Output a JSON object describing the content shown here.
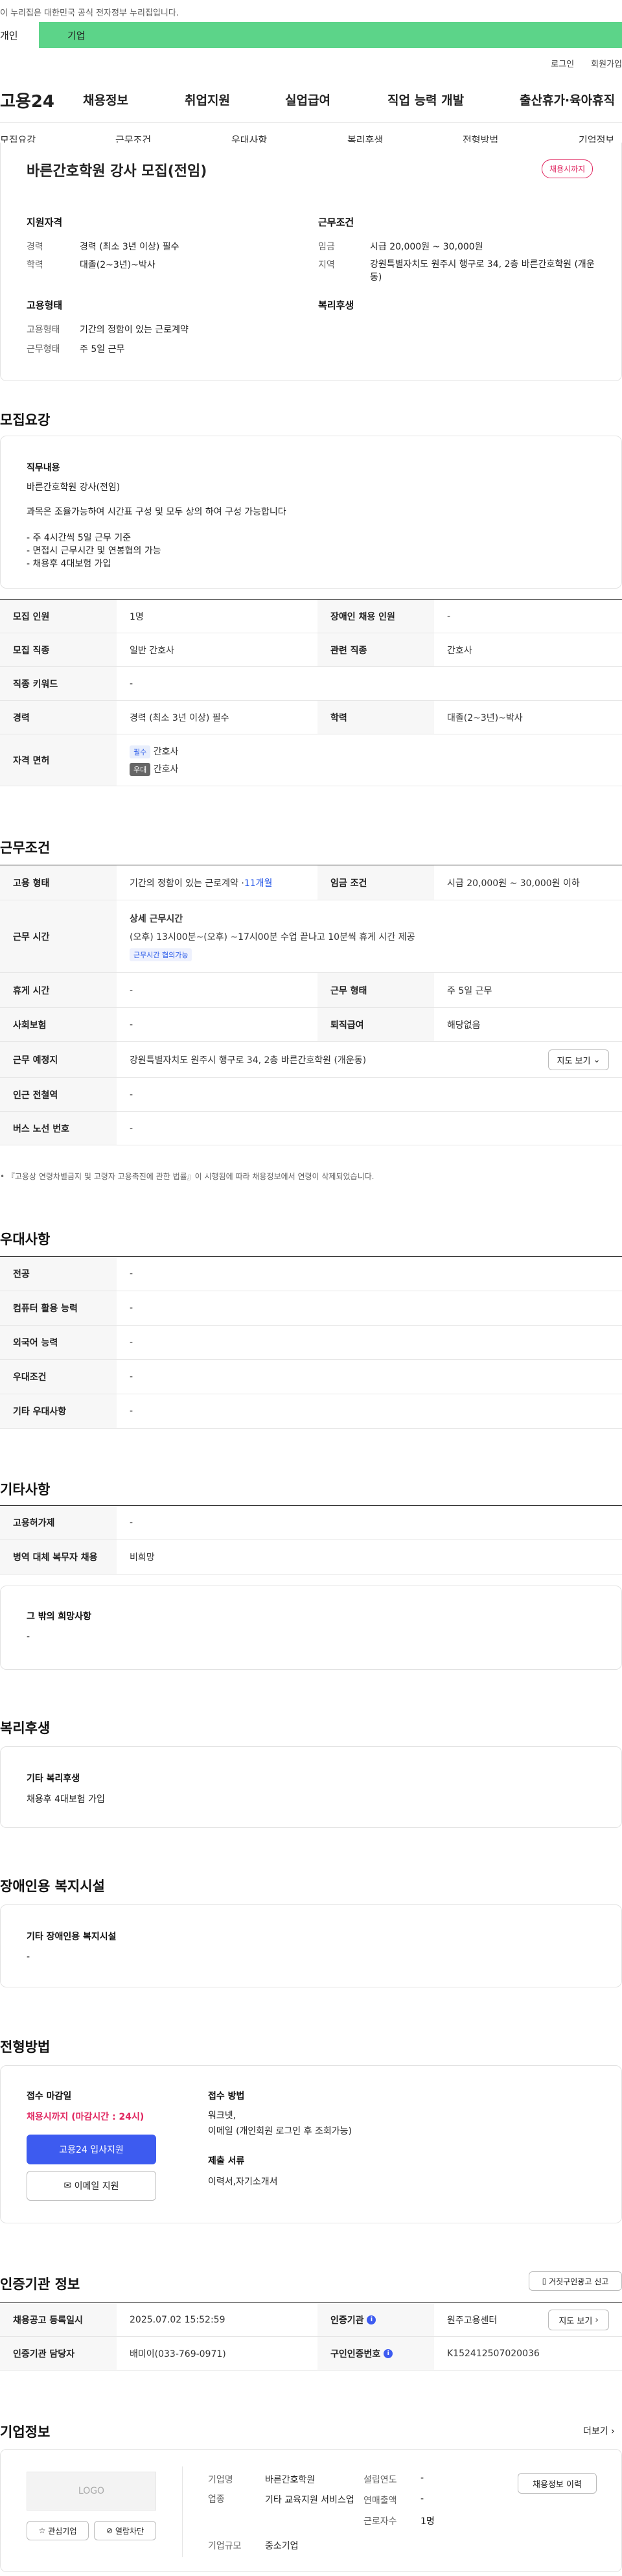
{
  "gov_banner": "이 누리집은 대한민국 공식 전자정부 누리집입니다.",
  "member_tabs": {
    "personal": "개인",
    "company": "기업"
  },
  "top_links": [
    "로그인",
    "회원가입"
  ],
  "logo": "고용24",
  "gnb": [
    "채용정보",
    "취업지원",
    "실업급여",
    "직업 능력 개발",
    "출산휴가·육아휴직"
  ],
  "snb": [
    "모집요강",
    "근무조건",
    "우대사항",
    "복리후생",
    "전형방법",
    "기업정보"
  ],
  "summary": {
    "title": "바른간호학원 강사 모집(전임)",
    "badge": "채용시까지",
    "qual_title": "지원자격",
    "cond_title": "근무조건",
    "exp_label": "경력",
    "exp_value": "경력 (최소 3년 이상) 필수",
    "edu_label": "학력",
    "edu_value": "대졸(2~3년)~박사",
    "wage_label": "임금",
    "wage_value": "시급 20,000원 ~ 30,000원",
    "region_label": "지역",
    "region_value": "강원특별자치도 원주시 행구로 34, 2층 바른간호학원 (개운동)",
    "emp_title": "고용형태",
    "welfare_title": "복리후생",
    "emptype_label": "고용형태",
    "emptype_value": "기간의 정함이 있는 근로계약",
    "worktype_label": "근무형태",
    "worktype_value": "주 5일 근무"
  },
  "recruit": {
    "heading": "모집요강",
    "duty_title": "직무내용",
    "duty_lines": [
      "바른간호학원 강사(전임)",
      "과목은 조율가능하여 시간표 구성 및 모두 상의 하여 구성 가능합니다",
      "- 주 4시간씩 5일 근무 기준",
      "- 면접시 근무시간  및 연봉협의 가능",
      "- 채용후 4대보험 가입"
    ],
    "rows": {
      "count_label": "모집 인원",
      "count_value": "1명",
      "disabled_label": "장애인 채용 인원",
      "disabled_value": "-",
      "job_label": "모집 직종",
      "job_value": "일반 간호사",
      "rel_label": "관련 직종",
      "rel_value": "간호사",
      "kw_label": "직종 키워드",
      "kw_value": "-",
      "career_label": "경력",
      "career_value": "경력 (최소 3년 이상) 필수",
      "school_label": "학력",
      "school_value": "대졸(2~3년)~박사",
      "license_label": "자격 면허",
      "license_items": [
        {
          "chip": "필수",
          "name": "간호사"
        },
        {
          "chip": "우대",
          "name": "간호사"
        }
      ]
    }
  },
  "conditions": {
    "heading": "근무조건",
    "emp_label": "고용 형태",
    "emp_value": "기간의 정함이 있는 근로계약 · ",
    "emp_months": "11개월",
    "wage_label": "임금 조건",
    "wage_value": "시급 20,000원 ~ 30,000원 이하",
    "time_label": "근무 시간",
    "time_title": "상세 근무시간",
    "time_value": "(오후) 13시00분~(오후) ~17시00분 수업 끝나고 10분씩 휴게 시간 제공",
    "time_chip": "근무시간 협의가능",
    "rest_label": "휴게 시간",
    "rest_value": "-",
    "form_label": "근무 형태",
    "form_value": "주 5일 근무",
    "ins_label": "사회보험",
    "ins_value": "-",
    "retire_label": "퇴직급여",
    "retire_value": "해당없음",
    "place_label": "근무 예정지",
    "place_value": "강원특별자치도 원주시 행구로 34, 2층 바른간호학원 (개운동)",
    "map_btn": "지도 보기",
    "subway_label": "인근 전철역",
    "subway_value": "-",
    "bus_label": "버스 노선 번호",
    "bus_value": "-",
    "note": "• 『고용상 연령차별금지 및 고령자 고용촉진에 관한 법률』이 시행됨에 따라 채용정보에서 연령이 삭제되었습니다."
  },
  "prefer": {
    "heading": "우대사항",
    "major_label": "전공",
    "major_value": "-",
    "pc_label": "컴퓨터 활용 능력",
    "pc_value": "-",
    "lang_label": "외국어 능력",
    "lang_value": "-",
    "cond_label": "우대조건",
    "cond_value": "-",
    "etc_label": "기타 우대사항",
    "etc_value": "-"
  },
  "etc": {
    "heading": "기타사항",
    "permit_label": "고용허가제",
    "permit_value": "-",
    "mil_label": "병역 대체 복무자 채용",
    "mil_value": "비희망",
    "hope_title": "그 밖의 희망사항",
    "hope_value": "-"
  },
  "welfare": {
    "heading": "복리후생",
    "title": "기타 복리후생",
    "value": "채용후 4대보험 가입"
  },
  "disabled_fac": {
    "heading": "장애인용 복지시설",
    "title": "기타 장애인용 복지시설",
    "value": "-"
  },
  "selection": {
    "heading": "전형방법",
    "deadline_title": "접수 마감일",
    "deadline_value": "채용시까지 (마감시간 : 24시)",
    "apply_btn": "고용24 입사지원",
    "email_btn": "이메일 지원",
    "method_title": "접수 방법",
    "method_lines": [
      "워크넷,",
      "이메일 (개인회원 로그인 후 조회가능)"
    ],
    "docs_title": "제출 서류",
    "docs_value": "이력서,자기소개서"
  },
  "agency": {
    "heading": "인증기관 정보",
    "report_btn": "거짓구인광고 신고",
    "reg_label": "채용공고 등록일시",
    "reg_value": "2025.07.02 15:52:59",
    "org_label": "인증기관",
    "org_value": "원주고용센터",
    "map_btn": "지도 보기",
    "mgr_label": "인증기관 담당자",
    "mgr_value": "배미이(033-769-0971)",
    "cert_label": "구인인증번호",
    "cert_value": "K152412507020036"
  },
  "company": {
    "heading": "기업정보",
    "more": "더보기",
    "logo_text": "LOGO",
    "fav_btn": "관심기업",
    "block_btn": "열람차단",
    "name_label": "기업명",
    "name_value": "바른간호학원",
    "ind_label": "업종",
    "ind_value": "기타 교육지원 서비스업",
    "size_label": "기업규모",
    "size_value": "중소기업",
    "year_label": "설립연도",
    "year_value": "-",
    "sales_label": "연매출액",
    "sales_value": "-",
    "emp_label": "근로자수",
    "emp_value": "1명",
    "hist_btn": "채용정보 이력"
  },
  "colors": {
    "green": "#5cd489",
    "red": "#e0245e",
    "blue": "#2456e8",
    "button": "#3d5bf0"
  }
}
